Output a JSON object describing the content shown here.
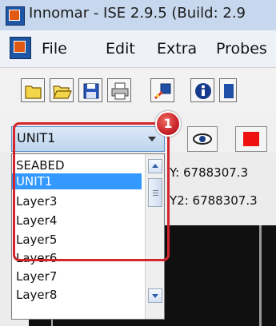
{
  "window": {
    "title": "Innomar - ISE 2.9.5 (Build: 2.9"
  },
  "menu": {
    "items": [
      "File",
      "Edit",
      "Extra",
      "Probes"
    ]
  },
  "unit_combo": {
    "selected": "UNIT1"
  },
  "dropdown": {
    "options": [
      "SEABED",
      "UNIT1",
      "Layer3",
      "Layer4",
      "Layer5",
      "Layer6",
      "Layer7",
      "Layer8"
    ],
    "selected_index": 1
  },
  "coordinates": {
    "line1": "Y:  6788307.3",
    "line2": "Y2: 6788307.3"
  },
  "annotation": {
    "marker_number": "1",
    "color": "#d4252c"
  },
  "colors": {
    "selection": "#3399ff",
    "stop": "#ee1111"
  }
}
